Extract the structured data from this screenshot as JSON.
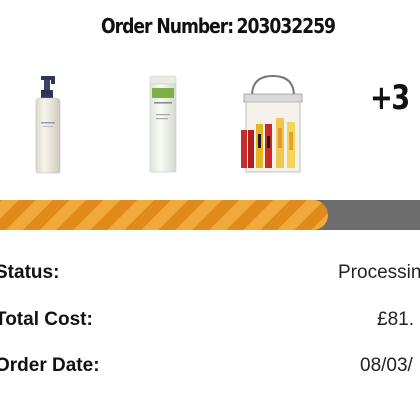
{
  "order": {
    "title_label": "Order Number:",
    "number": "203032259"
  },
  "products": {
    "more_count": "+3",
    "items": [
      {
        "name": "white-pump-bottle"
      },
      {
        "name": "green-label-bottle"
      },
      {
        "name": "gift-bag-lip-balms"
      }
    ]
  },
  "progress": {
    "fraction": 0.78
  },
  "details": {
    "status_label": "Status:",
    "status_value": "Processin",
    "total_label": "Total Cost:",
    "total_value": "£81.",
    "date_label": "Order Date:",
    "date_value": "08/03/"
  },
  "colors": {
    "progress_stripe_light": "#f2a93b",
    "progress_stripe_dark": "#e08a1c",
    "progress_track": "#6d6d6d"
  }
}
